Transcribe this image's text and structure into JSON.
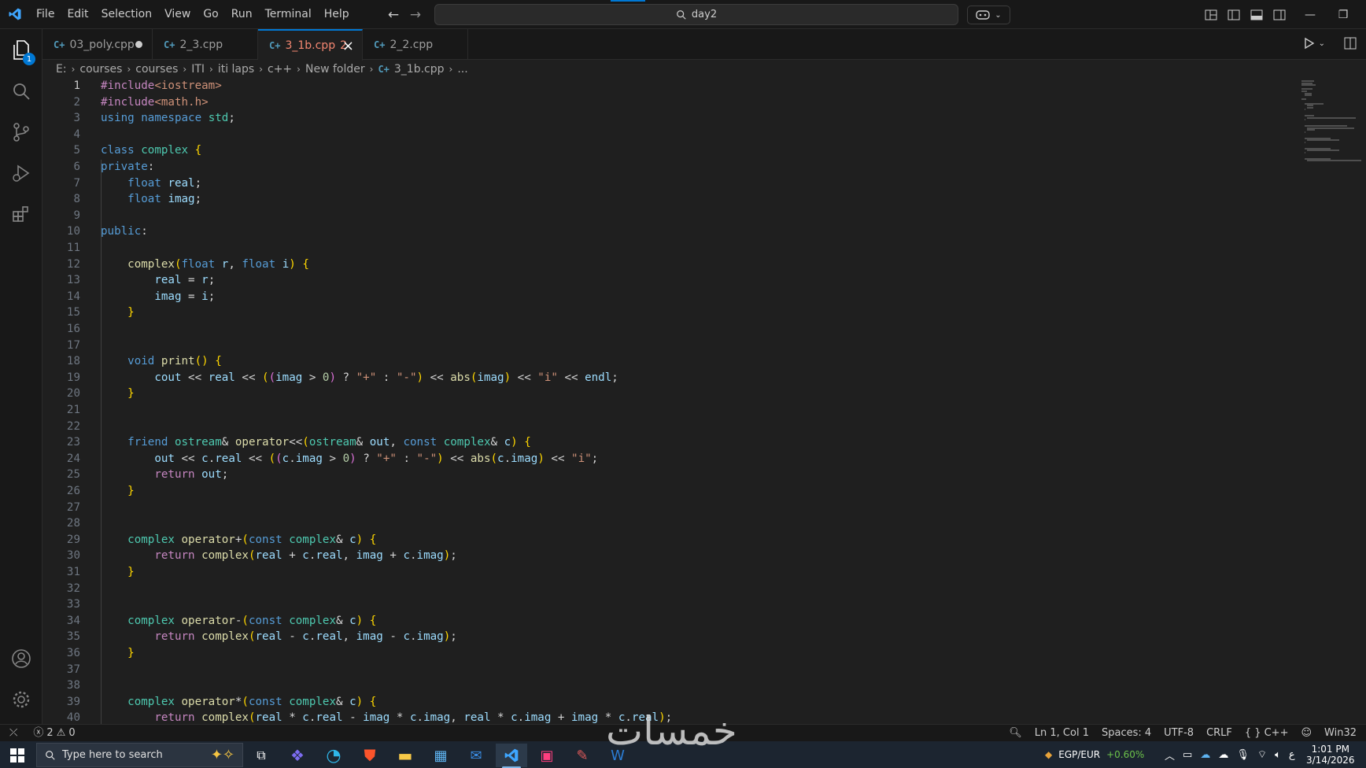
{
  "titlebar": {
    "menu": [
      "File",
      "Edit",
      "Selection",
      "View",
      "Go",
      "Run",
      "Terminal",
      "Help"
    ],
    "search_text": "day2"
  },
  "activity": {
    "explorer_badge": "1"
  },
  "tabs": [
    {
      "label": "03_poly.cpp",
      "state": "dirty"
    },
    {
      "label": "2_3.cpp",
      "state": "normal"
    },
    {
      "label": "3_1b.cpp",
      "state": "active",
      "errors": "2"
    },
    {
      "label": "2_2.cpp",
      "state": "normal"
    }
  ],
  "breadcrumb": [
    "E:",
    "courses",
    "courses",
    "ITI",
    "iti laps",
    "c++",
    "New folder",
    "3_1b.cpp",
    "..."
  ],
  "code_lines": [
    "#include<iostream>",
    "#include<math.h>",
    "using namespace std;",
    "",
    "class complex {",
    "private:",
    "    float real;",
    "    float imag;",
    "",
    "public:",
    "",
    "    complex(float r, float i) {",
    "        real = r;",
    "        imag = i;",
    "    }",
    "",
    "",
    "    void print() {",
    "        cout << real << ((imag > 0) ? \"+\" : \"-\") << abs(imag) << \"i\" << endl;",
    "    }",
    "",
    "",
    "    friend ostream& operator<<(ostream& out, const complex& c) {",
    "        out << c.real << ((c.imag > 0) ? \"+\" : \"-\") << abs(c.imag) << \"i\";",
    "        return out;",
    "    }",
    "",
    "",
    "    complex operator+(const complex& c) {",
    "        return complex(real + c.real, imag + c.imag);",
    "    }",
    "",
    "",
    "    complex operator-(const complex& c) {",
    "        return complex(real - c.real, imag - c.imag);",
    "    }",
    "",
    "",
    "    complex operator*(const complex& c) {",
    "        return complex(real * c.real - imag * c.imag, real * c.imag + imag * c.real);"
  ],
  "status": {
    "errors": "2",
    "warnings": "0",
    "position": "Ln 1, Col 1",
    "spaces": "Spaces: 4",
    "encoding": "UTF-8",
    "eol": "CRLF",
    "language": "C++",
    "platform": "Win32"
  },
  "taskbar": {
    "search_placeholder": "Type here to search",
    "ticker_label": "EGP/EUR",
    "ticker_change": "+0.60%",
    "time": "1:01 PM",
    "date": "3/14/2026"
  },
  "watermark": "خمسات",
  "colors": {
    "accent": "#0078d4",
    "editor_bg": "#1f1f1f",
    "taskbar_bg": "#1c2530"
  }
}
